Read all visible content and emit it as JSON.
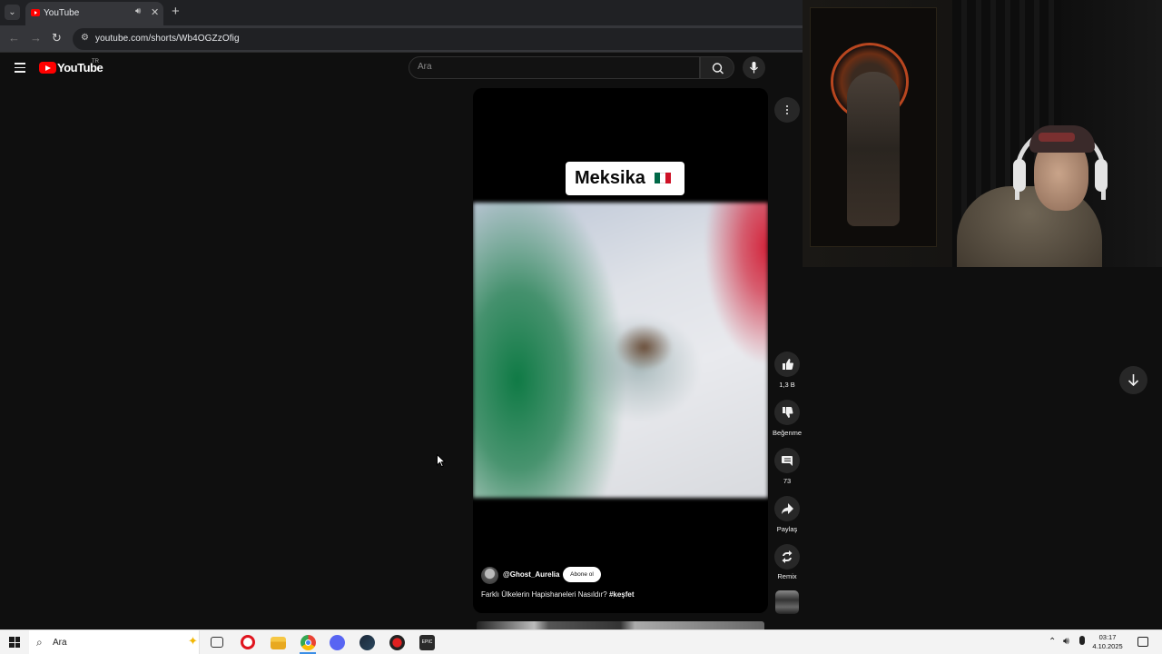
{
  "browser": {
    "tab": {
      "title": "YouTube"
    },
    "url": "youtube.com/shorts/Wb4OGZzOfig"
  },
  "masthead": {
    "logo_text": "YouTube",
    "country_code": "TR",
    "search_placeholder": "Ara"
  },
  "short": {
    "overlay_title": "Meksika",
    "flag_colors": [
      "#006847",
      "#ffffff",
      "#ce1126"
    ],
    "channel_handle": "@Ghost_Aurelia",
    "subscribe_label": "Abone ol",
    "caption_text": "Farklı Ülkelerin Hapishaneleri Nasıldır? ",
    "caption_hashtag": "#keşfet"
  },
  "actions": {
    "like_count": "1,3 B",
    "dislike_label": "Beğenme",
    "comment_count": "73",
    "share_label": "Paylaş",
    "remix_label": "Remix"
  },
  "taskbar": {
    "search_placeholder": "Ara",
    "apps": [
      "task-view",
      "opera",
      "file-explorer",
      "chrome",
      "discord",
      "steam",
      "app-red",
      "epic-games"
    ],
    "clock_time": "03:17",
    "clock_date": "4.10.2025"
  }
}
